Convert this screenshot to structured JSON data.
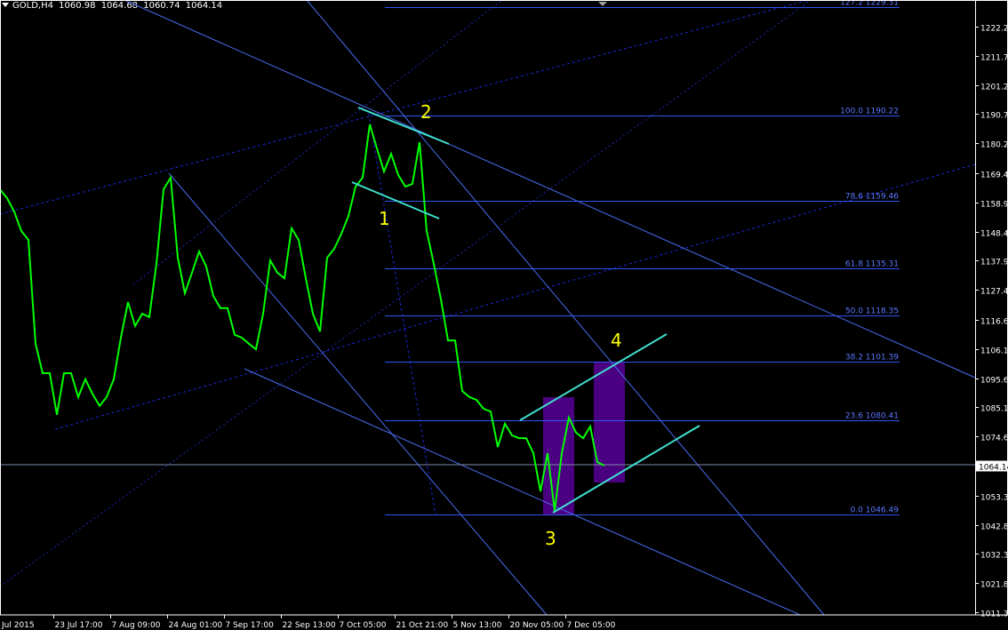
{
  "header": {
    "symbol": "GOLD,H4",
    "open": "1060.98",
    "high": "1064.68",
    "low": "1060.74",
    "close": "1064.14"
  },
  "colors": {
    "background": "#000000",
    "price_line": "#00ff00",
    "fib_lines": "#2f56f0",
    "fib_text": "#5a78ff",
    "trend_lines": "#4a6cf0",
    "dotted_lines": "#1a2ad8",
    "channel_lines": "#40e0d0",
    "boxes": "#4b0082",
    "wave_labels": "#ffff00",
    "axis": "#ffffff"
  },
  "chart_data": {
    "type": "line",
    "title": "GOLD,H4",
    "xlabel": "",
    "ylabel": "",
    "ylim": [
      1011.3,
      1222.2
    ],
    "grid": false,
    "x_ticks": [
      "Jul 2015",
      "23 Jul 17:00",
      "7 Aug 09:00",
      "24 Aug 01:00",
      "7 Sep 17:00",
      "22 Sep 13:00",
      "7 Oct 05:00",
      "21 Oct 21:00",
      "5 Nov 13:00",
      "20 Nov 05:00",
      "7 Dec 05:00"
    ],
    "y_ticks": [
      "1222.20",
      "1211.70",
      "1201.20",
      "1190.70",
      "1180.20",
      "1169.40",
      "1158.90",
      "1148.40",
      "1137.90",
      "1127.40",
      "1116.60",
      "1106.10",
      "1095.60",
      "1085.10",
      "1074.60",
      "1064.14",
      "1053.30",
      "1042.80",
      "1032.30",
      "1021.80",
      "1011.30"
    ],
    "current_price": "1064.14",
    "series": [
      {
        "values": [
          1163.6,
          1160.4,
          1155.6,
          1148.6,
          1145.4,
          1108.0,
          1097.4,
          1097.4,
          1082.4,
          1097.4,
          1097.4,
          1088.8,
          1095.2,
          1090.0,
          1085.6,
          1088.8,
          1095.2,
          1110.2,
          1123.0,
          1114.4,
          1118.8,
          1117.6,
          1136.8,
          1163.6,
          1167.8,
          1139.0,
          1126.2,
          1133.6,
          1141.2,
          1135.8,
          1125.2,
          1120.8,
          1120.8,
          1111.2,
          1110.2,
          1108.0,
          1106.0,
          1118.8,
          1138.0,
          1133.6,
          1131.6,
          1149.6,
          1145.4,
          1131.6,
          1118.8,
          1112.4,
          1139.0,
          1142.2,
          1147.6,
          1154.0,
          1164.6,
          1167.8,
          1187.0,
          1178.4,
          1170.0,
          1176.4,
          1168.8,
          1164.6,
          1165.6,
          1180.6,
          1148.6,
          1136.8,
          1124.0,
          1109.2,
          1109.2,
          1091.0,
          1088.8,
          1087.8,
          1084.6,
          1083.6,
          1070.8,
          1079.2,
          1075.0,
          1074.0,
          1074.0,
          1068.6,
          1054.8,
          1068.6,
          1047.8,
          1068.6,
          1081.4,
          1076.0,
          1074.0,
          1078.2,
          1065.4,
          1064.1
        ]
      }
    ],
    "fibonacci_levels": [
      {
        "label": "127.2 1229.31",
        "price": 1229.31
      },
      {
        "label": "100.0 1190.22",
        "price": 1190.22
      },
      {
        "label": "78.6 1159.46",
        "price": 1159.46
      },
      {
        "label": "61.8 1135.31",
        "price": 1135.31
      },
      {
        "label": "50.0  1118.35",
        "price": 1118.35
      },
      {
        "label": "38.2 1101.39",
        "price": 1101.39
      },
      {
        "label": "23.6 1080.41",
        "price": 1080.41
      },
      {
        "label": "0.0 1046.49",
        "price": 1046.49
      }
    ],
    "wave_labels": [
      "1",
      "2",
      "3",
      "4"
    ]
  }
}
